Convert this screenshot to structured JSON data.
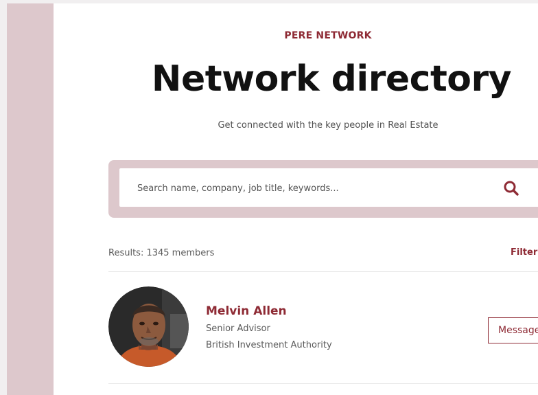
{
  "header": {
    "eyebrow": "PERE NETWORK",
    "title": "Network directory",
    "subtitle": "Get connected with the key people in Real Estate"
  },
  "search": {
    "placeholder": "Search name, company, job title, keywords...",
    "button_icon": "search-icon"
  },
  "results": {
    "label": "Results: 1345 members",
    "filter_label": "Filter"
  },
  "members": [
    {
      "name": "Melvin Allen",
      "title": "Senior Advisor",
      "company": "British Investment Authority",
      "message_label": "Message",
      "avatar_icon": "person-photo"
    }
  ],
  "colors": {
    "accent": "#8e2a34",
    "band": "#ddc8cc",
    "background": "#ffffff",
    "text_dark": "#111111",
    "text_muted": "#5a5a5a"
  }
}
